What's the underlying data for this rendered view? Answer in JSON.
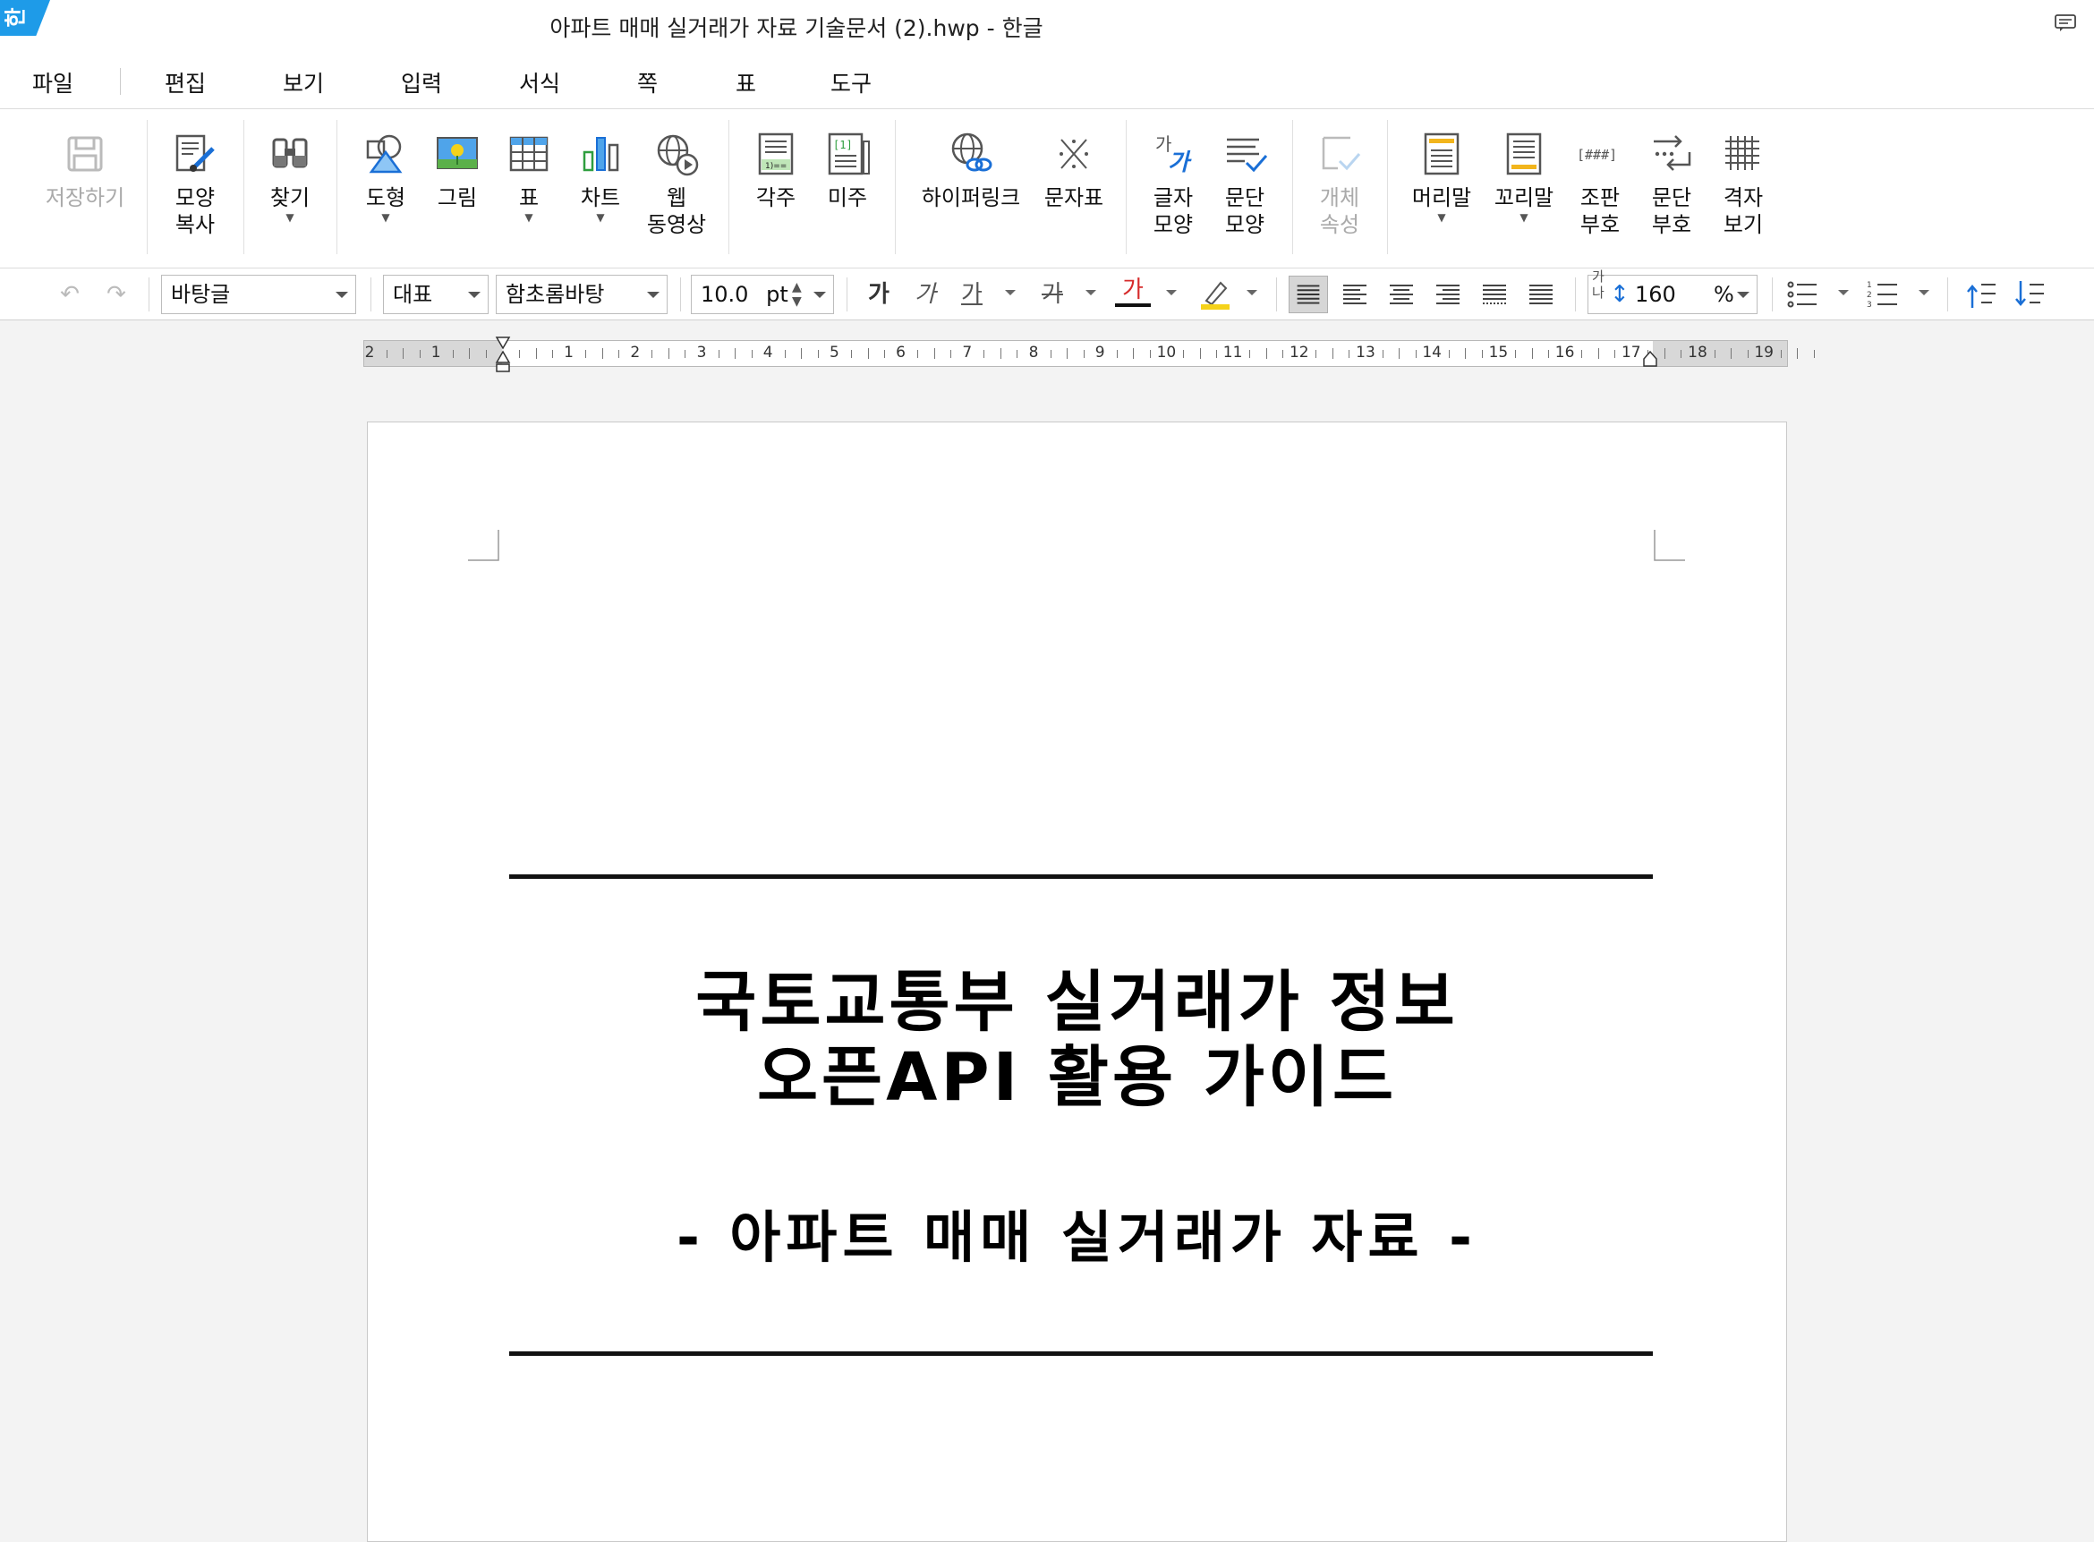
{
  "window": {
    "app_logo": "한",
    "title": "아파트 매매 실거래가 자료 기술문서 (2).hwp - 한글"
  },
  "menu": [
    "파일",
    "편집",
    "보기",
    "입력",
    "서식",
    "쪽",
    "표",
    "도구"
  ],
  "ribbon": {
    "save": "저장하기",
    "shape_copy": [
      "모양",
      "복사"
    ],
    "find": "찾기",
    "shape": "도형",
    "picture": "그림",
    "table": "표",
    "chart": "차트",
    "web_video": [
      "웹",
      "동영상"
    ],
    "footnote": "각주",
    "endnote": "미주",
    "hyperlink": "하이퍼링크",
    "char_map": "문자표",
    "char_shape": [
      "글자",
      "모양"
    ],
    "para_shape": [
      "문단",
      "모양"
    ],
    "object_props": [
      "개체",
      "속성"
    ],
    "header": "머리말",
    "footer": "꼬리말",
    "layout_mark": [
      "조판",
      "부호"
    ],
    "para_mark": [
      "문단",
      "부호"
    ],
    "grid_view": [
      "격자",
      "보기"
    ]
  },
  "format": {
    "style": "바탕글",
    "lang": "대표",
    "font": "함초롬바탕",
    "size": "10.0",
    "size_unit": "pt",
    "bold_glyph": "가",
    "italic_glyph": "가",
    "underline_glyph": "가",
    "strike_glyph": "가",
    "color_glyph": "가",
    "line_spacing": "160",
    "line_spacing_unit": "%",
    "line_spacing_icon_text": "가나"
  },
  "ruler": {
    "labels": [
      "2",
      "1",
      "",
      "1",
      "2",
      "3",
      "4",
      "5",
      "6",
      "7",
      "8",
      "9",
      "10",
      "11",
      "12",
      "13",
      "14",
      "15",
      "16",
      "17",
      "18",
      "19"
    ]
  },
  "document": {
    "title_line1": "국토교통부 실거래가 정보",
    "title_line2": "오픈API 활용 가이드",
    "subtitle": "- 아파트 매매 실거래가 자료 -"
  }
}
